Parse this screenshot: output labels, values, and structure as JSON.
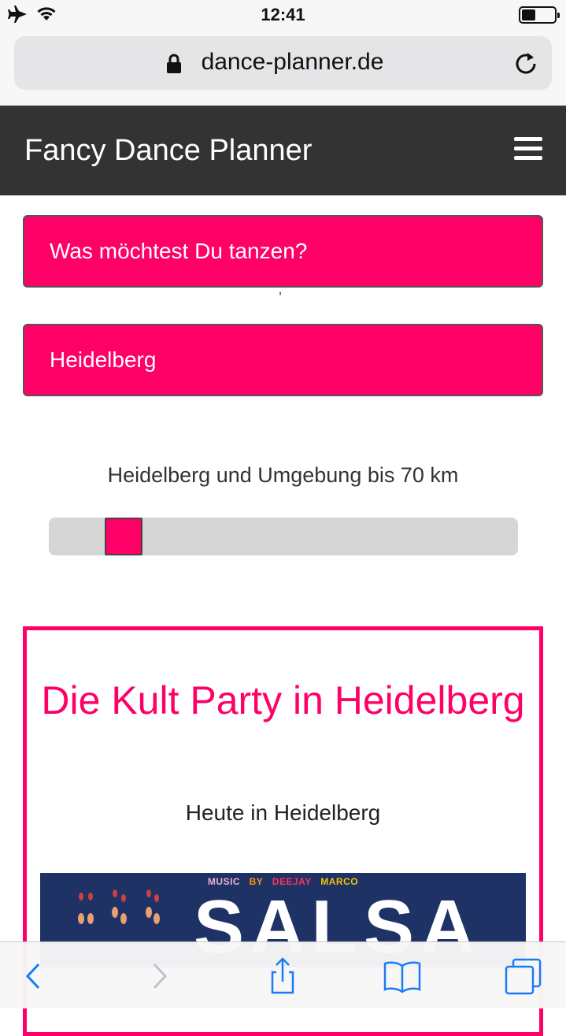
{
  "status_bar": {
    "time": "12:41",
    "icons": [
      "airplane-icon",
      "wifi-icon",
      "battery-icon"
    ]
  },
  "browser": {
    "url": "dance-planner.de",
    "icons": [
      "lock-icon",
      "reload-icon"
    ]
  },
  "navbar": {
    "brand": "Fancy Dance Planner",
    "menu_icon": "hamburger-icon"
  },
  "filters": {
    "dance_select": "Was möchtest Du tanzen?",
    "separator": "ʼ",
    "city_select": "Heidelberg"
  },
  "range": {
    "label": "Heidelberg und Umgebung bis 70 km",
    "value_fraction": 0.13
  },
  "event": {
    "title": "Die Kult Party in Heidelberg",
    "subtitle": "Heute in Heidelberg",
    "banner": {
      "top_words": [
        {
          "text": "MUSIC",
          "color": "#e9b0d0"
        },
        {
          "text": "BY",
          "color": "#ff9900"
        },
        {
          "text": "DEEJAY",
          "color": "#ff3355"
        },
        {
          "text": "MARCO",
          "color": "#f2c300"
        }
      ],
      "headline": "SALSA"
    }
  },
  "toolbar": {
    "buttons": [
      "back-icon",
      "forward-icon",
      "share-icon",
      "bookmarks-icon",
      "tabs-icon"
    ]
  },
  "colors": {
    "accent": "#ff0066",
    "navbar": "#333333",
    "banner": "#1f3266"
  }
}
